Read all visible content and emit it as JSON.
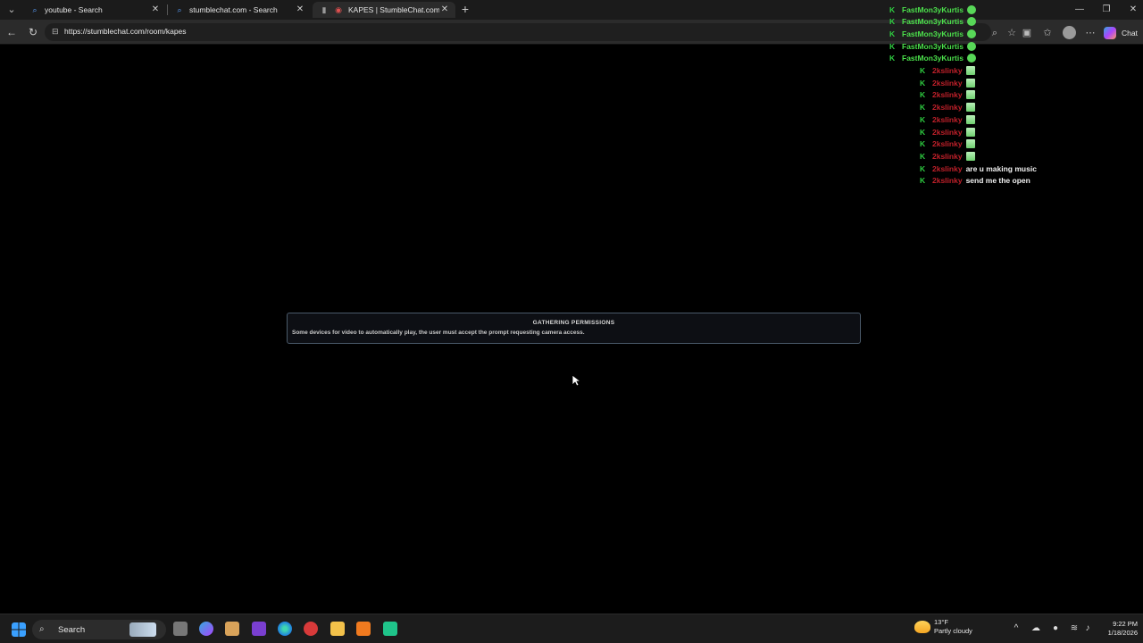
{
  "browser": {
    "tabs": [
      {
        "title": "youtube - Search",
        "favicon": "search-icon",
        "active": false
      },
      {
        "title": "stumblechat.com - Search",
        "favicon": "search-icon",
        "active": false
      },
      {
        "title": "KAPES | StumbleChat.com",
        "favicon": "stumblechat-icon",
        "active": true
      }
    ],
    "url": "https://stumblechat.com/room/kapes",
    "copilot_label": "Chat"
  },
  "chat": {
    "messages": [
      {
        "user": "FastMon3yKurtis",
        "color": "#4be04b",
        "emoji": "smile",
        "text": ""
      },
      {
        "user": "FastMon3yKurtis",
        "color": "#4be04b",
        "emoji": "smile",
        "text": ""
      },
      {
        "user": "FastMon3yKurtis",
        "color": "#4be04b",
        "emoji": "smile",
        "text": ""
      },
      {
        "user": "FastMon3yKurtis",
        "color": "#4be04b",
        "emoji": "smile",
        "text": ""
      },
      {
        "user": "FastMon3yKurtis",
        "color": "#4be04b",
        "emoji": "smile",
        "text": ""
      },
      {
        "user": "2kslinky",
        "color": "#c0202a",
        "emoji": "building",
        "text": ""
      },
      {
        "user": "2kslinky",
        "color": "#c0202a",
        "emoji": "building",
        "text": ""
      },
      {
        "user": "2kslinky",
        "color": "#c0202a",
        "emoji": "building",
        "text": ""
      },
      {
        "user": "2kslinky",
        "color": "#c0202a",
        "emoji": "building",
        "text": ""
      },
      {
        "user": "2kslinky",
        "color": "#c0202a",
        "emoji": "building",
        "text": ""
      },
      {
        "user": "2kslinky",
        "color": "#c0202a",
        "emoji": "building",
        "text": ""
      },
      {
        "user": "2kslinky",
        "color": "#c0202a",
        "emoji": "building",
        "text": ""
      },
      {
        "user": "2kslinky",
        "color": "#c0202a",
        "emoji": "building",
        "text": ""
      },
      {
        "user": "2kslinky",
        "color": "#c0202a",
        "emoji": "",
        "text": "are u making music"
      },
      {
        "user": "2kslinky",
        "color": "#c0202a",
        "emoji": "",
        "text": "send me the open"
      }
    ]
  },
  "modal": {
    "title": "GATHERING PERMISSIONS",
    "body": "Some devices for video to automatically play, the user must accept the prompt requesting camera access."
  },
  "taskbar": {
    "search_label": "Search",
    "weather_temp": "13°F",
    "weather_desc": "Partly cloudy",
    "time": "9:22 PM",
    "date": "1/18/2026"
  }
}
